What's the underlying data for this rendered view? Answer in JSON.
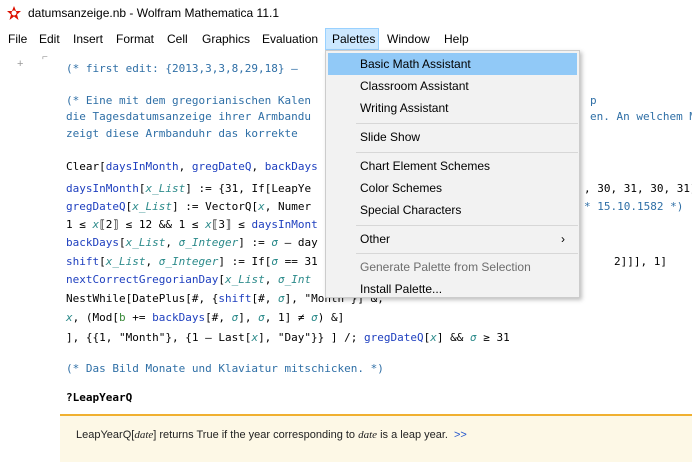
{
  "window": {
    "title": "datumsanzeige.nb - Wolfram Mathematica 11.1",
    "icon": "mathematica-icon"
  },
  "menubar": [
    "File",
    "Edit",
    "Insert",
    "Format",
    "Cell",
    "Graphics",
    "Evaluation",
    "Palettes",
    "Window",
    "Help"
  ],
  "palettes_menu": {
    "items": [
      "Basic Math Assistant",
      "Classroom Assistant",
      "Writing Assistant",
      "Slide Show",
      "Chart Element Schemes",
      "Color Schemes",
      "Special Characters",
      "Other",
      "Generate Palette from Selection",
      "Install Palette..."
    ],
    "submenu_arrow": "›"
  },
  "notebook": {
    "add_cell": "+",
    "cell_bracket": "⌐",
    "line1": "(*  first edit: {2013,3,3,8,29,18} –",
    "comment2a": "(* Eine mit dem gregorianischen Kalen",
    "comment2a_tail": "p",
    "comment2b": "die Tagesdatumsanzeige ihrer Armbandu",
    "comment2b_tail": "en. An welchem Mo",
    "comment2c": " zeigt diese Armbanduhr das korrekte",
    "code": {
      "l1a": "Clear[",
      "l1b": "daysInMonth",
      "l1c": ", ",
      "l1d": "gregDateQ",
      "l1e": ", ",
      "l1f": "backDays",
      "l2a": "daysInMonth",
      "l2b": "[",
      "l2c": "x_List",
      "l2d": "] := {31, If[LeapYe",
      "l2tail": ", 30, 31, 30, 31]⟧",
      "l3a": "gregDateQ",
      "l3b": "[",
      "l3c": "x_List",
      "l3d": "] := VectorQ[",
      "l3e": "x",
      "l3f": ", Numer",
      "l3tail": "* 15.10.1582 *)",
      "l4a": "  1 ≤ ",
      "l4b": "x",
      "l4c": "⟦2⟧ ≤ 12 && 1 ≤ ",
      "l4d": "x",
      "l4e": "⟦3⟧ ≤ ",
      "l4f": "daysInMont",
      "l5a": "backDays",
      "l5b": "[",
      "l5c": "x_List",
      "l5d": ", ",
      "l5e": "σ_Integer",
      "l5f": "] := ",
      "l5g": "σ",
      "l5h": " – day",
      "l6a": "shift",
      "l6b": "[",
      "l6c": "x_List",
      "l6d": ", ",
      "l6e": "σ_Integer",
      "l6f": "] := If[",
      "l6g": "σ",
      "l6h": " == 31",
      "l6tail": "2]]], 1]",
      "l7a": "nextCorrectGregorianDay",
      "l7b": "[",
      "l7c": "x_List",
      "l7d": ", ",
      "l7e": "σ_Int",
      "l8a": "    NestWhile[DatePlus[#, {",
      "l8b": "shift",
      "l8c": "[#, ",
      "l8d": "σ",
      "l8e": "], \"Month\"}] &,",
      "l9a": "     x",
      "l9b": ", (Mod[",
      "l9c": "b",
      "l9d": " += ",
      "l9e": "backDays",
      "l9f": "[#, ",
      "l9g": "σ",
      "l9h": "], ",
      "l9i": "σ",
      "l9j": ", 1] ≠ ",
      "l9k": "σ",
      "l9l": ") &]",
      "l10a": "  ], {{1, \"Month\"}, {1 – Last[",
      "l10b": "x",
      "l10c": "], \"Day\"}} ] /; ",
      "l10d": "gregDateQ",
      "l10e": "[",
      "l10f": "x",
      "l10g": "] && ",
      "l10h": "σ",
      "l10i": " ≥ 31"
    },
    "comment3": "(* Das Bild Monate und Klaviatur mitschicken. *)",
    "query": "?LeapYearQ",
    "info": {
      "pre": "LeapYearQ[",
      "arg1": "date",
      "mid": "] returns True if the year corresponding to ",
      "arg2": "date",
      "post": " is a leap year.",
      "more": ">>"
    }
  },
  "colors": {
    "menu_highlight": "#91c9f7",
    "active_menu": "#cce8ff",
    "comment": "#2f6fa6",
    "symbol": "#1e3fbf",
    "pattern": "#2b8a8a",
    "info_border": "#f0b030"
  }
}
